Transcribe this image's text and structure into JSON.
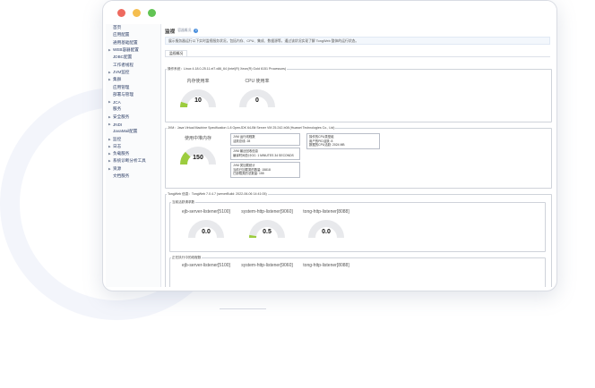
{
  "colors": {
    "window_close": "#ee6a5f",
    "window_minimize": "#f5be4f",
    "window_zoom": "#62c454",
    "gauge_track": "#e8e9ec",
    "gauge_fill": "#9ccc3e"
  },
  "sidebar": {
    "items": [
      {
        "label": "首页",
        "level": 0
      },
      {
        "label": "应用配置",
        "level": 1
      },
      {
        "label": "通用基础配置",
        "level": 1
      },
      {
        "label": "WEB容器配置",
        "level": 0,
        "expand": true
      },
      {
        "label": "JDBC配置",
        "level": 1
      },
      {
        "label": "工作者线程",
        "level": 1
      },
      {
        "label": "JVM监控",
        "level": 0,
        "expand": true
      },
      {
        "label": "集群",
        "level": 0,
        "expand": true
      },
      {
        "label": "应用管理",
        "level": 1
      },
      {
        "label": "部署与管理",
        "level": 1
      },
      {
        "label": "JCA",
        "level": 0,
        "expand": true
      },
      {
        "label": "服务",
        "level": 1
      },
      {
        "label": "安全服务",
        "level": 0,
        "expand": true
      },
      {
        "label": "JNDI",
        "level": 0,
        "expand": true
      },
      {
        "label": "JavaMail配置",
        "level": 1
      },
      {
        "label": "监控",
        "level": 0,
        "expand": true
      },
      {
        "label": "日志",
        "level": 0,
        "expand": true
      },
      {
        "label": "负载服务",
        "level": 0,
        "expand": true
      },
      {
        "label": "系统诊断分析工具",
        "level": 0,
        "expand": true
      },
      {
        "label": "资源",
        "level": 0,
        "expand": true
      },
      {
        "label": "文档服务",
        "level": 1
      }
    ]
  },
  "page": {
    "title": "监视",
    "subtitle": "容器概况",
    "help": "i",
    "intro": "展示服务器运行以下实时监视服务状况，包括内存、CPU、集成、数据源等，通过该状况实现了解 TongWeb 整体的运行状态。",
    "tab": "监视概况"
  },
  "os_panel": {
    "legend": "操作系统：Linux 4.18.0-25.11.el7.x86_64 (Intel(R) Xeon(R) Gold 6151 Processors)",
    "memory": {
      "title": "内存使用率",
      "value": "10",
      "level": 0.1,
      "min": "0",
      "max": "100"
    },
    "cpu": {
      "title": "CPU 使用率",
      "value": "0",
      "level": 0.0,
      "min": "0",
      "max": "100"
    }
  },
  "jvm_panel": {
    "legend": "JVM：Java Virtual Machine Specification 1.8  OpenJDK 64-Bit Server VM 25.242-b08 (Huawei Technologies Co., Ltd)",
    "heap": {
      "title": "使用中堆内存",
      "value": "150",
      "level": 0.25,
      "min": "0",
      "max": "582"
    },
    "box_threads": [
      "JVM 运行线程数",
      "活跃总线: 28"
    ],
    "box_gc": [
      "JVM 最近回收信息",
      "编译时间总计GC: 1 MINUTES 34 SECONDS"
    ],
    "box_classes": [
      "JVM 类加载统计",
      "当前已加载类的数量: 15818",
      "已卸载类的总数量: 155"
    ],
    "box_cpu": [
      "操作的CPU类型组",
      "用户的PID活跃: 8",
      "数据的CPU活跃: 2024 MB"
    ]
  },
  "tongweb_panel": {
    "legend": "TongWeb 信息：TongWeb 7.0.4.7 (serverBuild: 2022-06-06 14:41:05)",
    "active_legend": "当前活跃请求数",
    "busy_legend": "正在执行中的线程数",
    "listeners_active": [
      {
        "title": "ejb-server-listener[5100]",
        "value": "0.0",
        "level": 0.0
      },
      {
        "title": "system-http-listener[9060]",
        "value": "0.5",
        "level": 0.05
      },
      {
        "title": "tong-http-listener[8088]",
        "value": "0.0",
        "level": 0.0
      }
    ],
    "listeners_busy": [
      {
        "title": "ejb-server-listener[5100]"
      },
      {
        "title": "system-http-listener[9060]"
      },
      {
        "title": "tong-http-listener[8088]"
      }
    ],
    "ticks": {
      "min": "0",
      "mid1": "25",
      "mid2": "50",
      "max": "100"
    }
  }
}
